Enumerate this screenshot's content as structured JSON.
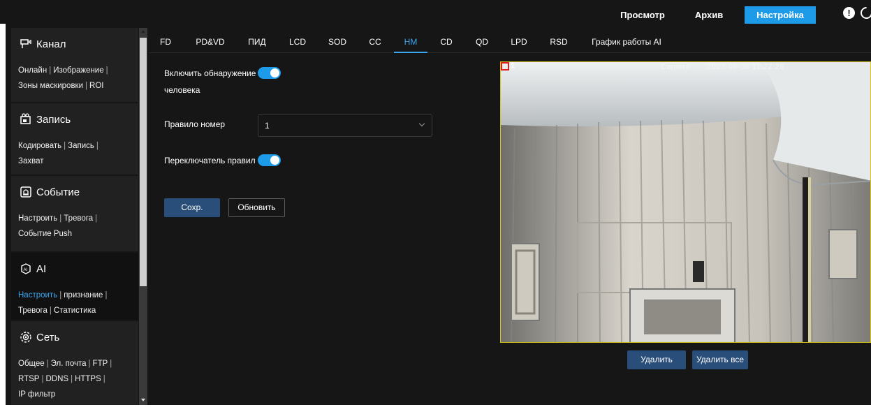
{
  "topnav": {
    "view": "Просмотр",
    "archive": "Архив",
    "settings": "Настройка"
  },
  "sidebar": {
    "sections": [
      {
        "title": "Канал",
        "icon": "channel-icon",
        "links": [
          "Онлайн",
          "Изображение",
          "Зоны маскировки",
          "ROI"
        ]
      },
      {
        "title": "Запись",
        "icon": "record-icon",
        "links": [
          "Кодировать",
          "Запись",
          "Захват"
        ]
      },
      {
        "title": "Событие",
        "icon": "event-icon",
        "links": [
          "Настроить",
          "Тревога",
          "Событие Push"
        ]
      },
      {
        "title": "AI",
        "icon": "ai-icon",
        "links": [
          "Настроить",
          "признание",
          "Тревога",
          "Статистика"
        ]
      },
      {
        "title": "Сеть",
        "icon": "network-icon",
        "links": [
          "Общее",
          "Эл. почта",
          "FTP",
          "RTSP",
          "DDNS",
          "HTTPS",
          "IP фильтр"
        ]
      }
    ]
  },
  "tabs": [
    "FD",
    "PD&VD",
    "ПИД",
    "LCD",
    "SOD",
    "CC",
    "HM",
    "CD",
    "QD",
    "LPD",
    "RSD",
    "График работы AI"
  ],
  "active_tab": "HM",
  "form": {
    "enable_label_line1": "Включить обнаружение",
    "enable_label_line2": "человека",
    "enable_on": true,
    "rule_number_label": "Правило номер",
    "rule_number_value": "1",
    "rule_switch_label": "Переключатель правил",
    "rule_switch_on": true,
    "save": "Сохр.",
    "refresh": "Обновить"
  },
  "video": {
    "camera_name": "Camera",
    "timestamp": "2023-06-08 11:22:26",
    "region_number": "1",
    "delete": "Удалить",
    "delete_all": "Удалить все"
  },
  "colors": {
    "accent": "#1e9be8",
    "button": "#2a4e7a",
    "background": "#161616",
    "region_border": "#d8c81a"
  }
}
